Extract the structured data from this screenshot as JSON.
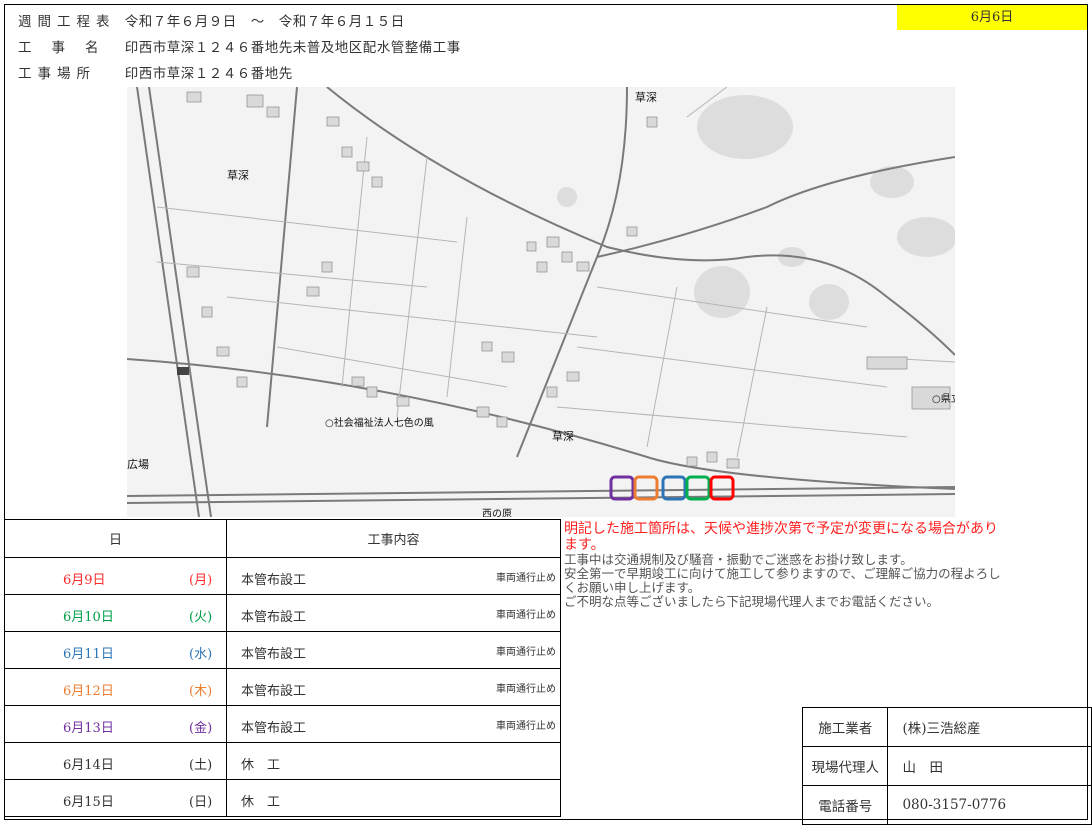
{
  "header": {
    "schedule_label": "週間工程表",
    "period": "令和７年６月９日　～　令和７年６月１５日",
    "issue_date": "6月6日",
    "project_label": "工事名",
    "project_name": "印西市草深１２４６番地先未普及地区配水管整備工事",
    "site_label": "工事場所",
    "site_name": "印西市草深１２４６番地先"
  },
  "map": {
    "labels": [
      "草深",
      "草深",
      "草深",
      "広場",
      "社会福祉法人七色の風",
      "県立",
      "西の原"
    ],
    "markers": [
      {
        "color": "#7030a0"
      },
      {
        "color": "#ed7d31"
      },
      {
        "color": "#2e75b6"
      },
      {
        "color": "#00b050"
      },
      {
        "color": "#ff0000"
      }
    ]
  },
  "schedule": {
    "col_day": "日",
    "col_work": "工事内容",
    "rows": [
      {
        "date": "6月9日",
        "weekday": "(月)",
        "work": "本管布設工",
        "note": "車両通行止め",
        "color": "#ff2a2a"
      },
      {
        "date": "6月10日",
        "weekday": "(火)",
        "work": "本管布設工",
        "note": "車両通行止め",
        "color": "#00a04a"
      },
      {
        "date": "6月11日",
        "weekday": "(水)",
        "work": "本管布設工",
        "note": "車両通行止め",
        "color": "#2e75b6"
      },
      {
        "date": "6月12日",
        "weekday": "(木)",
        "work": "本管布設工",
        "note": "車両通行止め",
        "color": "#ed7d31"
      },
      {
        "date": "6月13日",
        "weekday": "(金)",
        "work": "本管布設工",
        "note": "車両通行止め",
        "color": "#7030a0"
      },
      {
        "date": "6月14日",
        "weekday": "(土)",
        "work": "休　工",
        "note": "",
        "color": "#333333"
      },
      {
        "date": "6月15日",
        "weekday": "(日)",
        "work": "休　工",
        "note": "",
        "color": "#333333"
      }
    ]
  },
  "notice": {
    "warning": "明記した施工箇所は、天候や進捗次第で予定が変更になる場合があります。",
    "lines": [
      "工事中は交通規制及び騒音・振動でご迷惑をお掛け致します。",
      "安全第一で早期竣工に向けて施工して参りますので、ご理解ご協力の程よろしくお願い申し上げます。",
      "ご不明な点等ございましたら下記現場代理人までお電話ください。"
    ]
  },
  "contact": {
    "contractor_label": "施工業者",
    "contractor": "(株)三浩総産",
    "agent_label": "現場代理人",
    "agent": "山　田",
    "phone_label": "電話番号",
    "phone": "080-3157-0776"
  }
}
